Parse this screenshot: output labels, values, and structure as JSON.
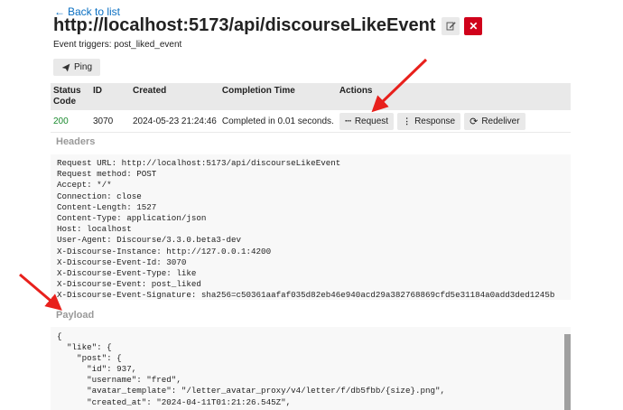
{
  "back_link": {
    "label": "Back to list"
  },
  "title": "http://localhost:5173/api/discourseLikeEvent",
  "triggers": "Event triggers: post_liked_event",
  "ping_label": "Ping",
  "table": {
    "headers": {
      "status": "Status Code",
      "id": "ID",
      "created": "Created",
      "completion": "Completion Time",
      "actions": "Actions"
    },
    "row": {
      "status": "200",
      "id": "3070",
      "created": "2024-05-23 21:24:46",
      "completion": "Completed in 0.01 seconds.",
      "request_label": "Request",
      "response_label": "Response",
      "redeliver_label": "Redeliver"
    }
  },
  "headers_label": "Headers",
  "headers_lines": [
    "Request URL: http://localhost:5173/api/discourseLikeEvent",
    "Request method: POST",
    "Accept: */*",
    "Connection: close",
    "Content-Length: 1527",
    "Content-Type: application/json",
    "Host: localhost",
    "User-Agent: Discourse/3.3.0.beta3-dev",
    "X-Discourse-Instance: http://127.0.0.1:4200",
    "X-Discourse-Event-Id: 3070",
    "X-Discourse-Event-Type: like",
    "X-Discourse-Event: post_liked",
    "X-Discourse-Event-Signature: sha256=c50361aafaf035d82eb46e940acd29a382768869cfd5e31184a0add3ded1245b"
  ],
  "payload_label": "Payload",
  "payload_lines": [
    "{",
    "  \"like\": {",
    "    \"post\": {",
    "      \"id\": 937,",
    "      \"username\": \"fred\",",
    "      \"avatar_template\": \"/letter_avatar_proxy/v4/letter/f/db5fbb/{size}.png\",",
    "      \"created_at\": \"2024-04-11T01:21:26.545Z\","
  ],
  "colors": {
    "link": "#0a6fc2",
    "danger": "#d0021b",
    "success": "#1a8a2e",
    "annotation": "#e8201c"
  },
  "icons": {
    "back": "arrow-left-icon",
    "edit": "pencil-icon",
    "delete": "times-icon",
    "ping": "paper-plane-icon",
    "request": "ellipsis-h-icon",
    "response": "ellipsis-v-icon",
    "redeliver": "sync-icon"
  }
}
